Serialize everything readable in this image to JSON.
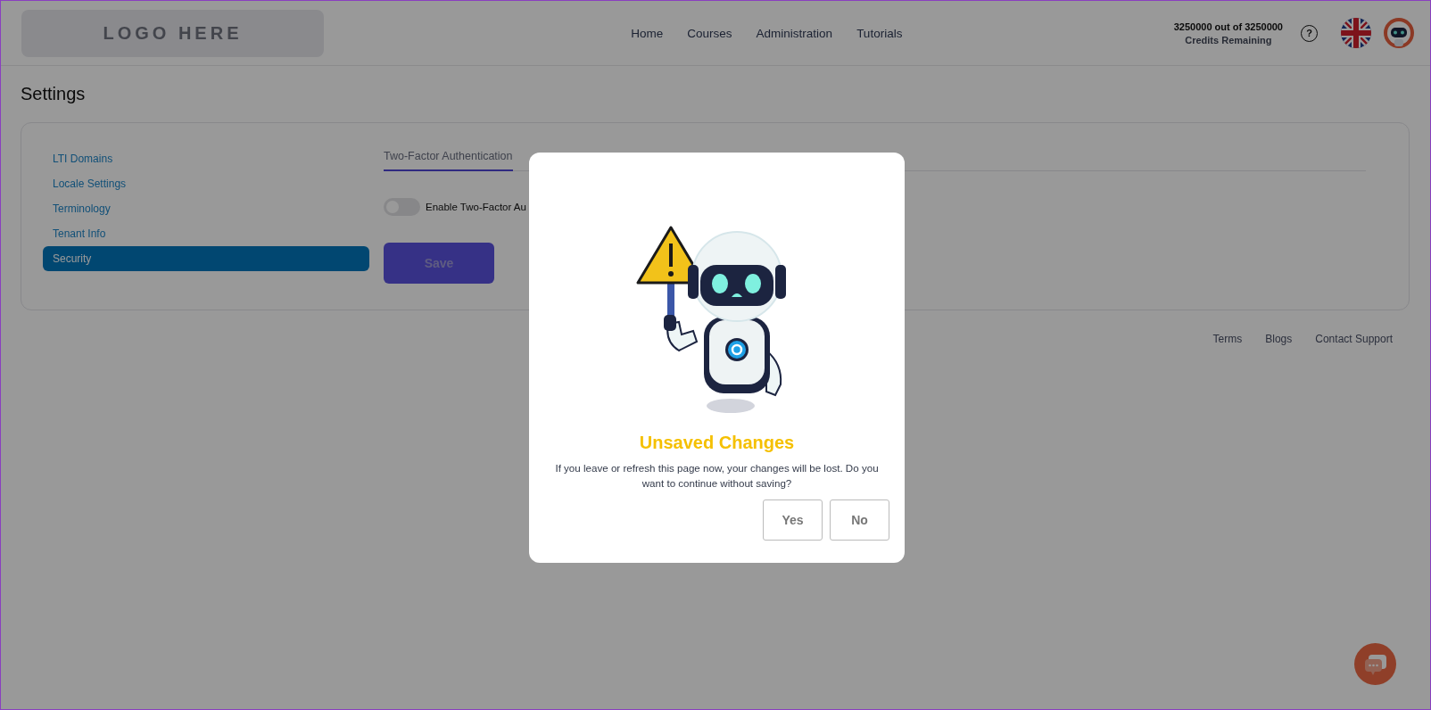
{
  "header": {
    "logo": "LOGO HERE",
    "nav": [
      {
        "label": "Home"
      },
      {
        "label": "Courses"
      },
      {
        "label": "Administration"
      },
      {
        "label": "Tutorials"
      }
    ],
    "credits": "3250000 out of 3250000",
    "credits_label": "Credits Remaining",
    "help_icon": "?"
  },
  "page_title": "Settings",
  "sidebar": {
    "items": [
      {
        "label": "LTI Domains",
        "selected": false
      },
      {
        "label": "Locale Settings",
        "selected": false
      },
      {
        "label": "Terminology",
        "selected": false
      },
      {
        "label": "Tenant Info",
        "selected": false
      },
      {
        "label": "Security",
        "selected": true
      }
    ]
  },
  "tabs": [
    {
      "label": "Two-Factor Authentication",
      "selected": true
    }
  ],
  "toggle": {
    "label": "Enable Two-Factor Au",
    "on": false
  },
  "save_button": "Save",
  "footer": {
    "links": [
      "Terms",
      "Blogs",
      "Contact Support"
    ]
  },
  "dialog": {
    "title": "Unsaved Changes",
    "message": "If you leave or refresh this page now, your changes will be lost. Do you want to continue without saving?",
    "buttons": [
      "Yes",
      "No"
    ]
  }
}
